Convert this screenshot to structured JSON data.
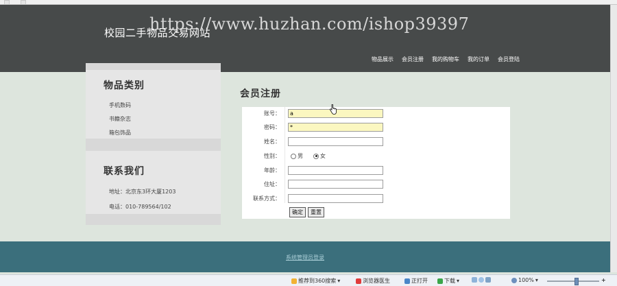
{
  "header": {
    "site_title": "校园二手物品交易网站",
    "watermark": "https://www.huzhan.com/ishop39397",
    "nav": [
      "物品展示",
      "会员注册",
      "我的购物车",
      "我的订单",
      "会员登陆"
    ]
  },
  "sidebar": {
    "categories_title": "物品类别",
    "categories": [
      "手机数码",
      "书籍杂志",
      "箱包饰品"
    ],
    "contact_title": "联系我们",
    "address": "地址：北京东3环大厦1203",
    "phone": "电话：010-789564/102"
  },
  "main": {
    "title": "会员注册",
    "form": {
      "account_label": "账号：",
      "account_value": "a",
      "password_label": "密码：",
      "password_value": "*",
      "name_label": "姓名：",
      "gender_label": "性别：",
      "gender_male": "男",
      "gender_female": "女",
      "gender_selected": "女",
      "age_label": "年龄：",
      "address_label": "住址：",
      "contact_label": "联系方式：",
      "submit_label": "确定",
      "reset_label": "重置"
    }
  },
  "footer": {
    "admin_link": "系统管理员登录"
  },
  "statusbar": {
    "items": [
      "推荐到360搜索",
      "浏览器医生",
      "正打开",
      "下载"
    ],
    "zoom": "100%"
  },
  "colors": {
    "header_bg": "#474a4a",
    "page_bg": "#dde5dd",
    "footer_bg": "#3b6f7c",
    "field_highlight": "#fbf7c0"
  }
}
